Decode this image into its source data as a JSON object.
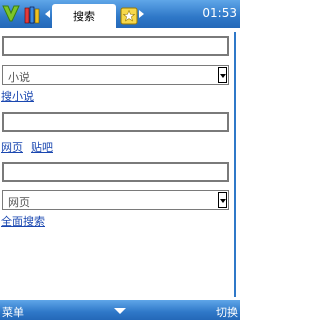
{
  "status_bar": {
    "active_tab": "搜索",
    "clock": "01:53",
    "icons": [
      "app-logo-icon",
      "bookshelf-icon",
      "favorites-icon"
    ]
  },
  "novel_search": {
    "input_value": "",
    "category_selected": "小说",
    "search_link": "搜小说"
  },
  "web_search": {
    "input_value": "",
    "links": [
      "网页",
      "贴吧"
    ]
  },
  "full_search": {
    "input_value": "",
    "category_selected": "网页",
    "search_link": "全面搜索"
  },
  "softkeys": {
    "left": "菜单",
    "right": "切换"
  },
  "colors": {
    "bar_blue": "#2f78c8",
    "link_blue": "#1a47b0"
  }
}
